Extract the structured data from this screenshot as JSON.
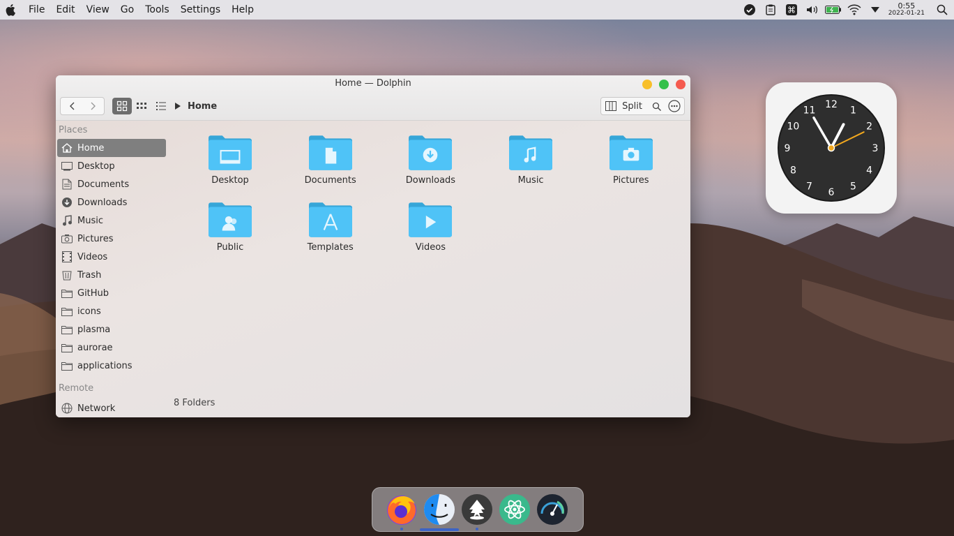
{
  "menubar": {
    "menus": [
      "File",
      "Edit",
      "View",
      "Go",
      "Tools",
      "Settings",
      "Help"
    ],
    "clock_time": "0:55",
    "clock_date": "2022-01-21"
  },
  "window": {
    "title": "Home — Dolphin",
    "breadcrumb": "Home",
    "split_label": "Split",
    "status": "8 Folders"
  },
  "sidebar": {
    "places_header": "Places",
    "remote_header": "Remote",
    "items": [
      {
        "label": "Home",
        "icon": "home-icon",
        "active": true
      },
      {
        "label": "Desktop",
        "icon": "desktop-icon"
      },
      {
        "label": "Documents",
        "icon": "documents-icon"
      },
      {
        "label": "Downloads",
        "icon": "downloads-icon"
      },
      {
        "label": "Music",
        "icon": "music-icon"
      },
      {
        "label": "Pictures",
        "icon": "pictures-icon"
      },
      {
        "label": "Videos",
        "icon": "videos-icon"
      },
      {
        "label": "Trash",
        "icon": "trash-icon"
      },
      {
        "label": "GitHub",
        "icon": "folder-icon"
      },
      {
        "label": "icons",
        "icon": "folder-icon"
      },
      {
        "label": "plasma",
        "icon": "folder-icon"
      },
      {
        "label": "aurorae",
        "icon": "folder-icon"
      },
      {
        "label": "applications",
        "icon": "folder-icon"
      }
    ],
    "remote_items": [
      {
        "label": "Network",
        "icon": "network-icon"
      }
    ]
  },
  "folders": [
    {
      "label": "Desktop",
      "icon": "desktop-folder-icon"
    },
    {
      "label": "Documents",
      "icon": "documents-folder-icon"
    },
    {
      "label": "Downloads",
      "icon": "downloads-folder-icon"
    },
    {
      "label": "Music",
      "icon": "music-folder-icon"
    },
    {
      "label": "Pictures",
      "icon": "pictures-folder-icon"
    },
    {
      "label": "Public",
      "icon": "public-folder-icon"
    },
    {
      "label": "Templates",
      "icon": "templates-folder-icon"
    },
    {
      "label": "Videos",
      "icon": "videos-folder-icon"
    }
  ],
  "clock_widget": {
    "numbers": [
      "12",
      "1",
      "2",
      "3",
      "4",
      "5",
      "6",
      "7",
      "8",
      "9",
      "10",
      "11"
    ]
  },
  "dock": {
    "apps": [
      "firefox-icon",
      "finder-icon",
      "inkscape-icon",
      "atom-icon",
      "system-monitor-icon"
    ]
  },
  "colors": {
    "folder_blue": "#4fc3f7",
    "close_red": "#f55b4f",
    "minimize_yellow": "#f8bf2a",
    "maximize_green": "#34c04a"
  }
}
